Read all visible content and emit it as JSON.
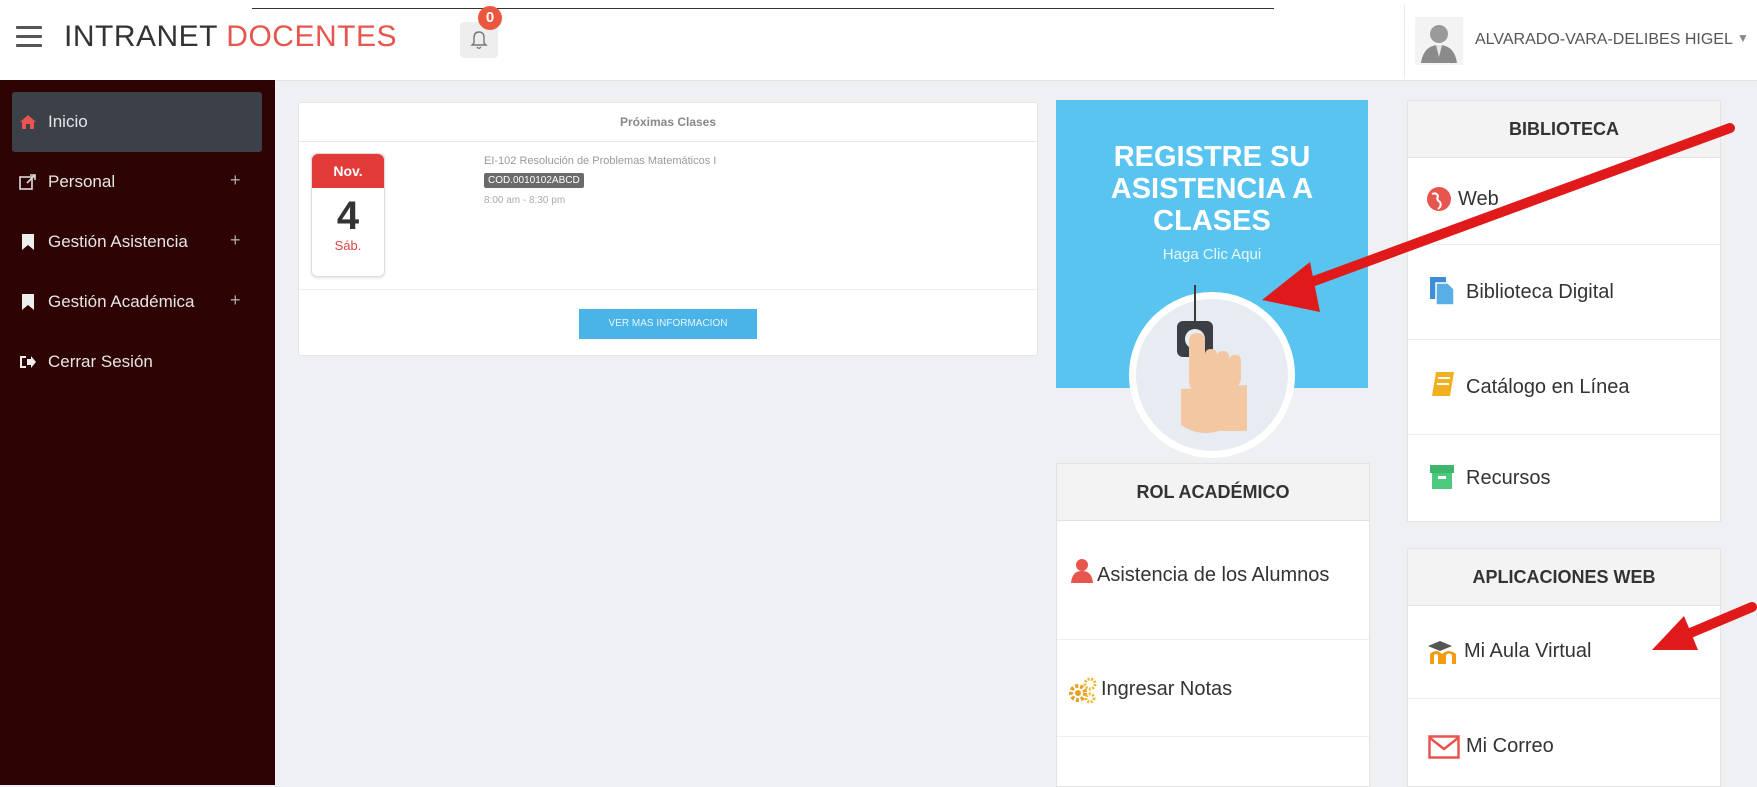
{
  "header": {
    "brand_part1": "INTRANET ",
    "brand_part2": "DOCENTES",
    "notification_count": "0",
    "user_name": "ALVARADO-VARA-DELIBES HIGEL"
  },
  "sidebar": {
    "items": [
      {
        "label": "Inicio",
        "icon": "home-icon"
      },
      {
        "label": "Personal",
        "icon": "external-link-icon"
      },
      {
        "label": "Gestión Asistencia",
        "icon": "bookmark-icon"
      },
      {
        "label": "Gestión Académica",
        "icon": "bookmark-icon"
      },
      {
        "label": "Cerrar Sesión",
        "icon": "sign-out-icon"
      }
    ],
    "expand_symbol": "+"
  },
  "proximas_clases": {
    "title": "Próximas Clases",
    "calendar": {
      "month": "Nov.",
      "day": "4",
      "weekday": "Sáb."
    },
    "clase_title": "EI-102 Resolución de Problemas Matemáticos I",
    "clase_code": "COD.0010102ABCD",
    "clase_time": "8:00 am - 8:30 pm",
    "button": "VER MAS INFORMACION"
  },
  "asistencia_banner": {
    "line1": "REGISTRE SU",
    "line2": "ASISTENCIA A",
    "line3": "CLASES",
    "sub": "Haga Clic Aqui"
  },
  "rol_academico": {
    "title": "ROL ACADÉMICO",
    "items": [
      "Asistencia de los Alumnos",
      "Ingresar Notas"
    ]
  },
  "biblioteca": {
    "title": "BIBLIOTECA",
    "items": [
      "Web",
      "Biblioteca Digital",
      "Catálogo en Línea",
      "Recursos"
    ]
  },
  "aplicaciones_web": {
    "title": "APLICACIONES WEB",
    "items": [
      "Mi Aula Virtual",
      "Mi Correo"
    ]
  },
  "colors": {
    "brand_accent": "#e8554e",
    "sidebar_bg": "#2e0303",
    "banner_bg": "#5ac4f0",
    "annotation_arrow": "#e01a1a"
  }
}
